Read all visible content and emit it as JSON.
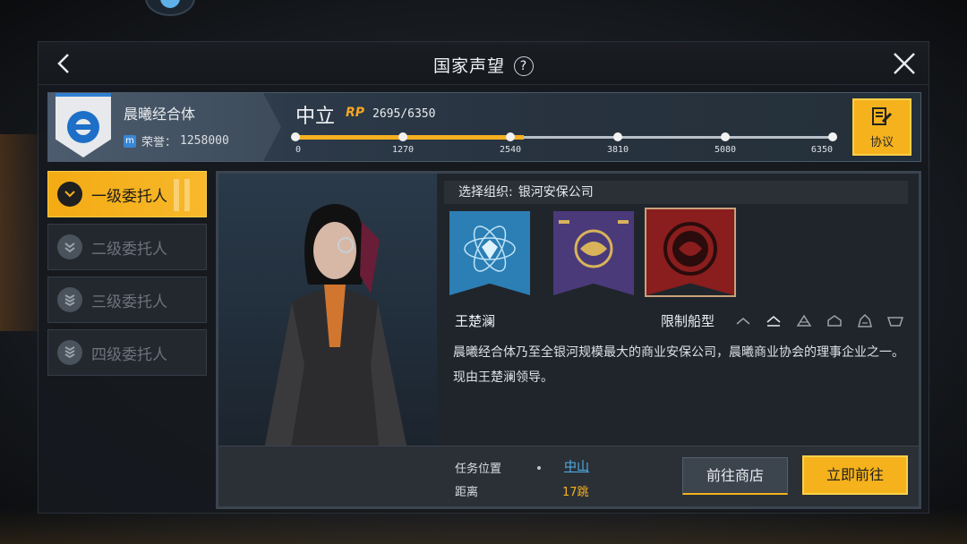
{
  "window": {
    "title": "国家声望",
    "help_icon": "?"
  },
  "org": {
    "name": "晨曦经合体",
    "honor_label": "荣誉：",
    "honor_value": "1258000",
    "honor_icon": "m",
    "badge_color": "#2f7fd0"
  },
  "reputation": {
    "standing": "中立",
    "rp_label": "RP",
    "rp_value": "2695/6350",
    "progress_fraction": 0.4244,
    "thresholds": [
      "0",
      "1270",
      "2540",
      "3810",
      "5080",
      "6350"
    ]
  },
  "protocol_button": {
    "label": "协议",
    "icon": "document-edit-icon"
  },
  "tabs": [
    {
      "label": "一级委托人",
      "active": true
    },
    {
      "label": "二级委托人",
      "active": false
    },
    {
      "label": "三级委托人",
      "active": false
    },
    {
      "label": "四级委托人",
      "active": false
    }
  ],
  "content": {
    "select_label": "选择组织:",
    "select_value": "银河安保公司",
    "banners": [
      {
        "name": "atom-crystal-emblem",
        "color": "#2b7fb5",
        "selected": false
      },
      {
        "name": "dragon-glyph-emblem",
        "color": "#4a3a7a",
        "selected": false
      },
      {
        "name": "dragon-seal-emblem",
        "color": "#8a1d1d",
        "selected": true
      }
    ],
    "leader_name": "王楚澜",
    "ship_restriction_label": "限制船型",
    "description": "晨曦经合体乃至全银河规模最大的商业安保公司，晨曦商业协会的理事企业之一。现由王楚澜领导。"
  },
  "footer": {
    "location_label": "任务位置",
    "location_value": "中山",
    "distance_label": "距离",
    "distance_value": "17跳",
    "shop_button": "前往商店",
    "go_button": "立即前往"
  },
  "colors": {
    "accent": "#f5b21c",
    "link": "#4fb3e8"
  }
}
